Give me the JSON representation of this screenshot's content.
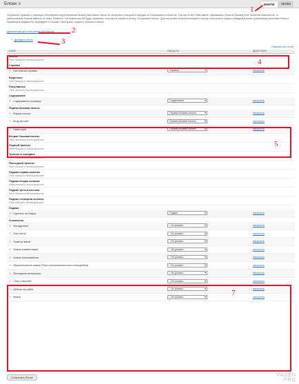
{
  "header": {
    "title": "Блоки",
    "tabs": [
      {
        "label": "BARTIK",
        "active": true
      },
      {
        "label": "SEVEN",
        "active": false
      }
    ]
  },
  "description": "На данной странице с помощью интерфейса перетаскивания можно расставить блоки по областям и настроить порядок их следования в областях. Так как не все темы имеют одинаковые области и вывод этих областей изменяется, то расположение блоков зависит от темы. Помните, что изменения не будут записаны, пока вы не нажмете кнопку «Сохранить блоки». Для настройки блока используйте ссылку «настроить» рядом с каждым блоком. Для выбора заголовка блока и параметров видимости, перейдите по ссылке «настроить» рядом с блоком в списке.",
  "links": {
    "demo": "Демонстрация блок-регионов (Bartik)",
    "add": "Добавить блок",
    "show_weights": "Показать вес строк"
  },
  "table": {
    "headers": [
      "БЛОК",
      "ОБЛАСТЬ",
      "ДЕЙСТВИЯ"
    ],
    "empty_text": "Нет блоков в этом регионе",
    "configure": "настроить",
    "none_option": "- Не указано -",
    "regions": [
      {
        "name": "Шапка",
        "blocks": []
      },
      {
        "name": "Справка",
        "blocks": [
          {
            "name": "Системная справка",
            "region": "Справка"
          }
        ]
      },
      {
        "name": "Выделено",
        "blocks": []
      },
      {
        "name": "Популярные",
        "blocks": []
      },
      {
        "name": "Содержимое",
        "blocks": [
          {
            "name": "Содержимое страницы",
            "region": "Содержимое"
          }
        ]
      },
      {
        "name": "Первая боковая панель",
        "blocks": [
          {
            "name": "Форма поиска",
            "region": "Первая боковая панель"
          },
          {
            "name": "Вход на сайт",
            "region": "Первая боковая панель"
          },
          {
            "name": "Навигация",
            "region": "Первая боковая панель"
          }
        ]
      },
      {
        "name": "Вторая боковая панель",
        "blocks": []
      },
      {
        "name": "Первый триптих",
        "blocks": []
      },
      {
        "name": "Триптих в середине",
        "blocks": []
      },
      {
        "name": "Последний триптих",
        "blocks": []
      },
      {
        "name": "Подвал первая колонка",
        "blocks": []
      },
      {
        "name": "Подвал вторая колонка",
        "blocks": []
      },
      {
        "name": "Подвал третья колонка",
        "blocks": []
      },
      {
        "name": "Подвал четвертая колонка",
        "blocks": []
      },
      {
        "name": "Подвал",
        "blocks": [
          {
            "name": "Сделано на Drupal",
            "region": "Подвал"
          }
        ]
      },
      {
        "name": "Отключено",
        "blocks": [
          {
            "name": "Management",
            "region": "- Не указано -"
          },
          {
            "name": "User menu",
            "region": "- Не указано -"
          },
          {
            "name": "Главное меню",
            "region": "- Не указано -"
          },
          {
            "name": "Новые комментарии",
            "region": "- Не указано -"
          },
          {
            "name": "Новые пользователи",
            "region": "- Не указано -"
          },
          {
            "name": "Переключатель языка (Текст пользовательского интерфейса)",
            "region": "- Не указано -"
          },
          {
            "name": "Последние материалы",
            "region": "- Не указано -"
          },
          {
            "name": "Сбор новостей",
            "region": "- Не указано -"
          },
          {
            "name": "Сейчас на сайте",
            "region": "- Не указано -"
          },
          {
            "name": "Фрики",
            "region": "- Не указано -"
          }
        ]
      }
    ]
  },
  "save_button": "Сохранить блоки",
  "annotations": [
    "1",
    "2",
    "3",
    "4",
    "5",
    "7"
  ],
  "watermark": [
    "VADEN",
    "PRO"
  ],
  "colors": {
    "annotation": "#e0102c",
    "link": "#2b6ca3"
  }
}
